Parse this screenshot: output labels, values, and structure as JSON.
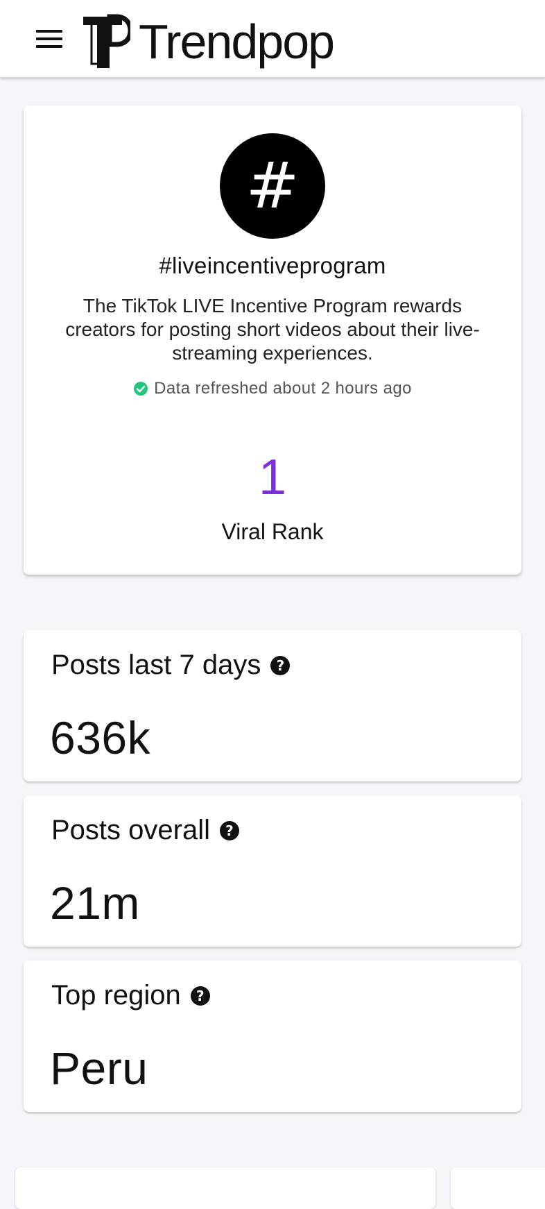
{
  "header": {
    "menu_icon": "hamburger-menu-icon",
    "brand_name": "Trendpop"
  },
  "hashtag": {
    "icon_glyph": "#",
    "title": "#liveincentiveprogram",
    "description": "The TikTok LIVE Incentive Program rewards creators for posting short videos about their live-streaming experiences.",
    "refresh_status": "Data refreshed about 2 hours ago",
    "rank_value": "1",
    "rank_label": "Viral Rank"
  },
  "stats": [
    {
      "label": "Posts last 7 days",
      "value": "636k",
      "help_icon": "help-circle-icon"
    },
    {
      "label": "Posts overall",
      "value": "21m",
      "help_icon": "help-circle-icon"
    },
    {
      "label": "Top region",
      "value": "Peru",
      "help_icon": "help-circle-icon"
    }
  ],
  "colors": {
    "accent_purple": "#7b2fd8",
    "status_green": "#22c47e",
    "page_background": "#f4f6fa"
  }
}
